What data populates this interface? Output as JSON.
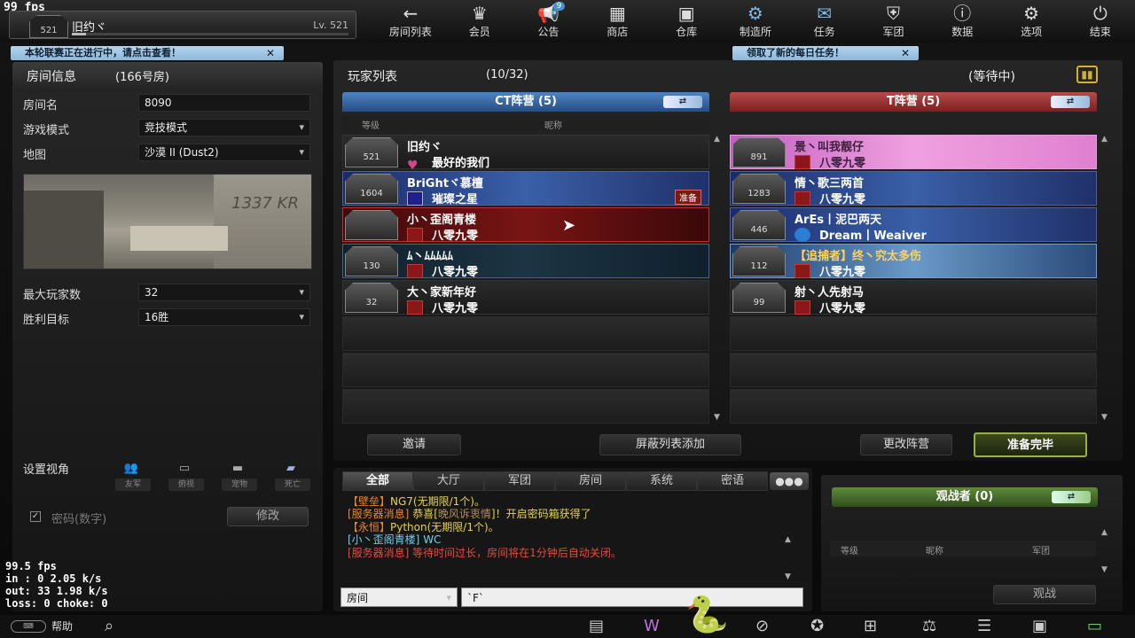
{
  "fps_top": "99 fps",
  "user": {
    "rank": "521",
    "name": "旧约ヾ",
    "level": "Lv. 521",
    "xp_fraction": 0.05
  },
  "nav": [
    {
      "label": "房间列表",
      "icon": "←",
      "name": "back-arrow-icon"
    },
    {
      "label": "会员",
      "icon": "♛",
      "name": "crown-icon"
    },
    {
      "label": "公告",
      "icon": "📢",
      "name": "megaphone-icon",
      "badge": "9"
    },
    {
      "label": "商店",
      "icon": "▦",
      "name": "shop-icon"
    },
    {
      "label": "仓库",
      "icon": "▣",
      "name": "warehouse-icon"
    },
    {
      "label": "制造所",
      "icon": "⚙",
      "name": "factory-icon"
    },
    {
      "label": "任务",
      "icon": "✉",
      "name": "mission-icon"
    },
    {
      "label": "军团",
      "icon": "⛨",
      "name": "legion-icon"
    },
    {
      "label": "数据",
      "icon": "ⓘ",
      "name": "data-icon"
    },
    {
      "label": "选项",
      "icon": "⚙",
      "name": "gear-icon"
    },
    {
      "label": "结束",
      "icon": "⏻",
      "name": "power-icon"
    }
  ],
  "notices": {
    "left": "本轮联赛正在进行中，请点击查看！",
    "right": "领取了新的每日任务！",
    "close": "✕"
  },
  "room": {
    "header": "房间信息",
    "room_no": "(166号房)",
    "name_label": "房间名",
    "name_value": "8090",
    "mode_label": "游戏模式",
    "mode_value": "竞技模式",
    "map_label": "地图",
    "map_value": "沙漠 II (Dust2)",
    "max_label": "最大玩家数",
    "max_value": "32",
    "win_label": "胜利目标",
    "win_value": "16胜",
    "view_label": "设置视角",
    "view_options": [
      "友军",
      "俯视",
      "宠物",
      "死亡"
    ],
    "password_label": "密码(数字)",
    "modify": "修改"
  },
  "players": {
    "title": "玩家列表",
    "count": "(10/32)",
    "status": "(等待中)",
    "col_level": "等级",
    "col_nick": "昵称",
    "ct": {
      "title": "CT阵营 (5)",
      "slots": [
        {
          "rank": "521",
          "name": "旧约ヾ",
          "clan": "最好的我们",
          "clan_icon": "heart"
        },
        {
          "rank": "1604",
          "name": "BriGhtヾ慕檀",
          "clan": "璀璨之星",
          "clan_icon": "purple",
          "ready": "准备"
        },
        {
          "rank": "",
          "name": "小丶歪阁青楼",
          "clan": "八零九零",
          "clan_icon": "red"
        },
        {
          "rank": "130",
          "name": "ﾑ丶ﾑﾑﾑﾑﾑ",
          "clan": "八零九零",
          "clan_icon": "red"
        },
        {
          "rank": "32",
          "name": "大丶家新年好",
          "clan": "八零九零",
          "clan_icon": "red"
        }
      ]
    },
    "t": {
      "title": "T阵营 (5)",
      "slots": [
        {
          "rank": "891",
          "name": "景丶叫我靓仔",
          "clan": "八零九零",
          "clan_icon": "red"
        },
        {
          "rank": "1283",
          "name": "情丶歌三两首",
          "clan": "八零九零",
          "clan_icon": "red"
        },
        {
          "rank": "446",
          "name": "ArEs丨泥巴两天",
          "clan": "Dream丨Weaiver",
          "clan_icon": "blue"
        },
        {
          "rank": "112",
          "name": "【追捕者】终丶究太多伤",
          "clan": "八零九零",
          "clan_icon": "red"
        },
        {
          "rank": "99",
          "name": "射丶人先射马",
          "clan": "八零九零",
          "clan_icon": "red"
        }
      ]
    },
    "buttons": {
      "invite": "邀请",
      "block": "屏蔽列表添加",
      "change_team": "更改阵营",
      "ready": "准备完毕"
    }
  },
  "chat": {
    "tabs": [
      "全部",
      "大厅",
      "军团",
      "房间",
      "系统",
      "密语"
    ],
    "messages": [
      {
        "parts": [
          [
            "o",
            "【壁垒】"
          ],
          [
            "y",
            "NG7(无期限/1个)。"
          ]
        ]
      },
      {
        "parts": [
          [
            "o",
            "[服务器消息]"
          ],
          [
            "y",
            " 恭喜["
          ],
          [
            "p",
            "晚风诉衷情"
          ],
          [
            "y",
            "]！开启密码箱获得了"
          ]
        ]
      },
      {
        "parts": [
          [
            "o",
            "【永恒】"
          ],
          [
            "y",
            "Python(无期限/1个)。"
          ]
        ]
      },
      {
        "parts": [
          [
            "c",
            "[小丶歪阁青楼]"
          ],
          [
            "c",
            " WC"
          ]
        ]
      },
      {
        "parts": [
          [
            "r",
            "[服务器消息] 等待时间过长，房间将在1分钟后自动关闭。"
          ]
        ]
      }
    ],
    "channel": "房间",
    "input": "`F`"
  },
  "spectators": {
    "title": "观战者 (0)",
    "cols": [
      "等级",
      "昵称",
      "军团"
    ],
    "watch": "观战"
  },
  "net": {
    "fps": "99.5 fps",
    "in": "in :  0 2.05 k/s",
    "out": "out:  33 1.98 k/s",
    "loss": "loss: 0 choke:  0"
  },
  "footer": {
    "help": "帮助"
  }
}
